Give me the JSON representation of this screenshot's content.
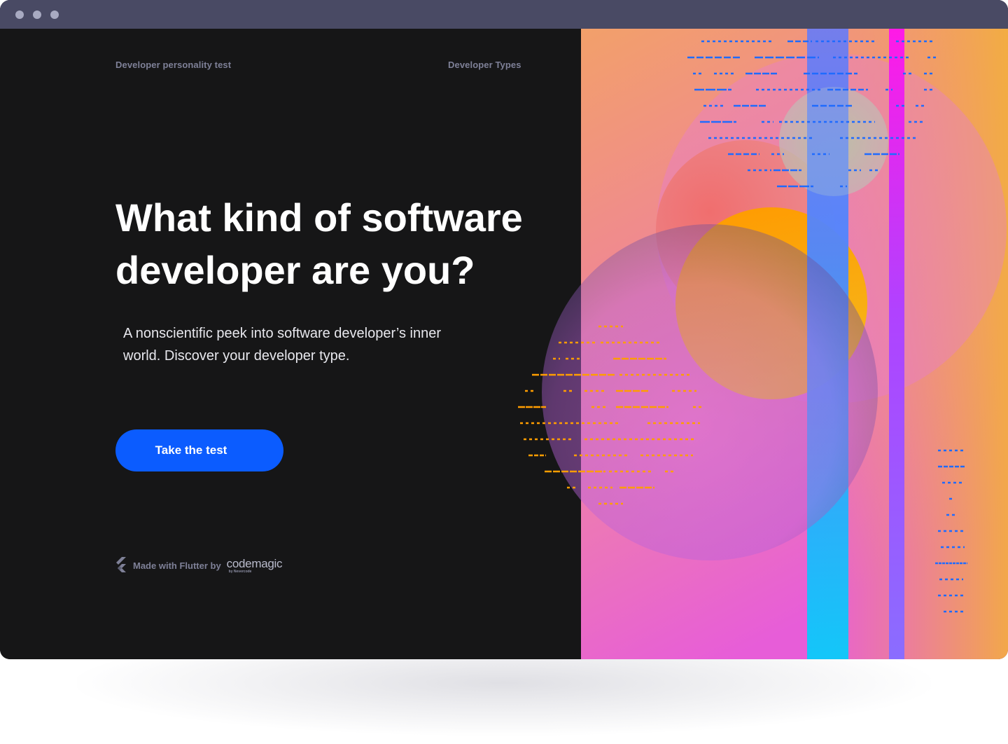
{
  "window": {
    "controls": [
      "window-dot",
      "window-dot",
      "window-dot"
    ]
  },
  "nav": {
    "left_link": "Developer personality test",
    "right_link": "Developer Types"
  },
  "hero": {
    "headline": "What kind of software developer are you?",
    "subtitle": "A nonscientific peek into software developer’s inner world. Discover your developer type.",
    "cta_label": "Take the test"
  },
  "footer": {
    "made_with": "Made with Flutter by",
    "brand": "codemagic",
    "brand_sub": "by Nevercode",
    "icon": "flutter-logo-icon"
  },
  "colors": {
    "background": "#161617",
    "titlebar": "#494a64",
    "accent": "#0b5cff",
    "nav_text": "#7e8097",
    "art_gradient_top": "#f2a06a",
    "art_gradient_mid": "#f088a8",
    "art_gradient_bottom": "#e95bd6",
    "dash_blue": "#1f6bff",
    "dash_orange": "#ff9d00",
    "stripe_cyan": "#16c8ff",
    "stripe_magenta": "#ff1ae0"
  }
}
